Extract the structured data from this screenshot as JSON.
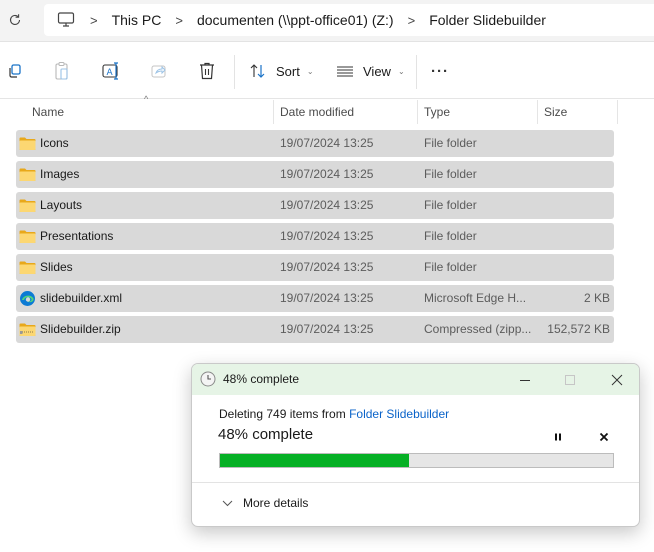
{
  "address_bar": {
    "refresh_icon": "refresh-icon",
    "computer_icon": "monitor-icon",
    "breadcrumbs": [
      "This PC",
      "documenten (\\\\ppt-office01) (Z:)",
      "Folder Slidebuilder"
    ],
    "separator": ">"
  },
  "toolbar": {
    "copy_icon": "copy-icon",
    "paste_icon": "paste-icon",
    "rename_icon": "rename-icon",
    "share_icon": "share-icon",
    "delete_icon": "trash-icon",
    "sort_label": "Sort",
    "view_label": "View",
    "more_label": "···"
  },
  "columns": {
    "name": "Name",
    "date_modified": "Date modified",
    "type": "Type",
    "size": "Size",
    "sort_indicator": "^"
  },
  "files": [
    {
      "name": "Icons",
      "date": "19/07/2024 13:25",
      "type": "File folder",
      "size": "",
      "icon": "folder-icon"
    },
    {
      "name": "Images",
      "date": "19/07/2024 13:25",
      "type": "File folder",
      "size": "",
      "icon": "folder-icon"
    },
    {
      "name": "Layouts",
      "date": "19/07/2024 13:25",
      "type": "File folder",
      "size": "",
      "icon": "folder-icon"
    },
    {
      "name": "Presentations",
      "date": "19/07/2024 13:25",
      "type": "File folder",
      "size": "",
      "icon": "folder-icon"
    },
    {
      "name": "Slides",
      "date": "19/07/2024 13:25",
      "type": "File folder",
      "size": "",
      "icon": "folder-icon"
    },
    {
      "name": "slidebuilder.xml",
      "date": "19/07/2024 13:25",
      "type": "Microsoft Edge H...",
      "size": "2 KB",
      "icon": "edge-icon"
    },
    {
      "name": "Slidebuilder.zip",
      "date": "19/07/2024 13:25",
      "type": "Compressed (zipp...",
      "size": "152,572 KB",
      "icon": "zip-folder-icon"
    }
  ],
  "progress_dialog": {
    "title": "48% complete",
    "description_prefix": "Deleting 749 items from ",
    "description_link": "Folder Slidebuilder",
    "percent_text": "48% complete",
    "progress": 0.48,
    "more_details_label": "More details",
    "accent_color": "#06b025",
    "title_bar_color": "#e6f4e6",
    "link_color": "#0a63c9"
  }
}
